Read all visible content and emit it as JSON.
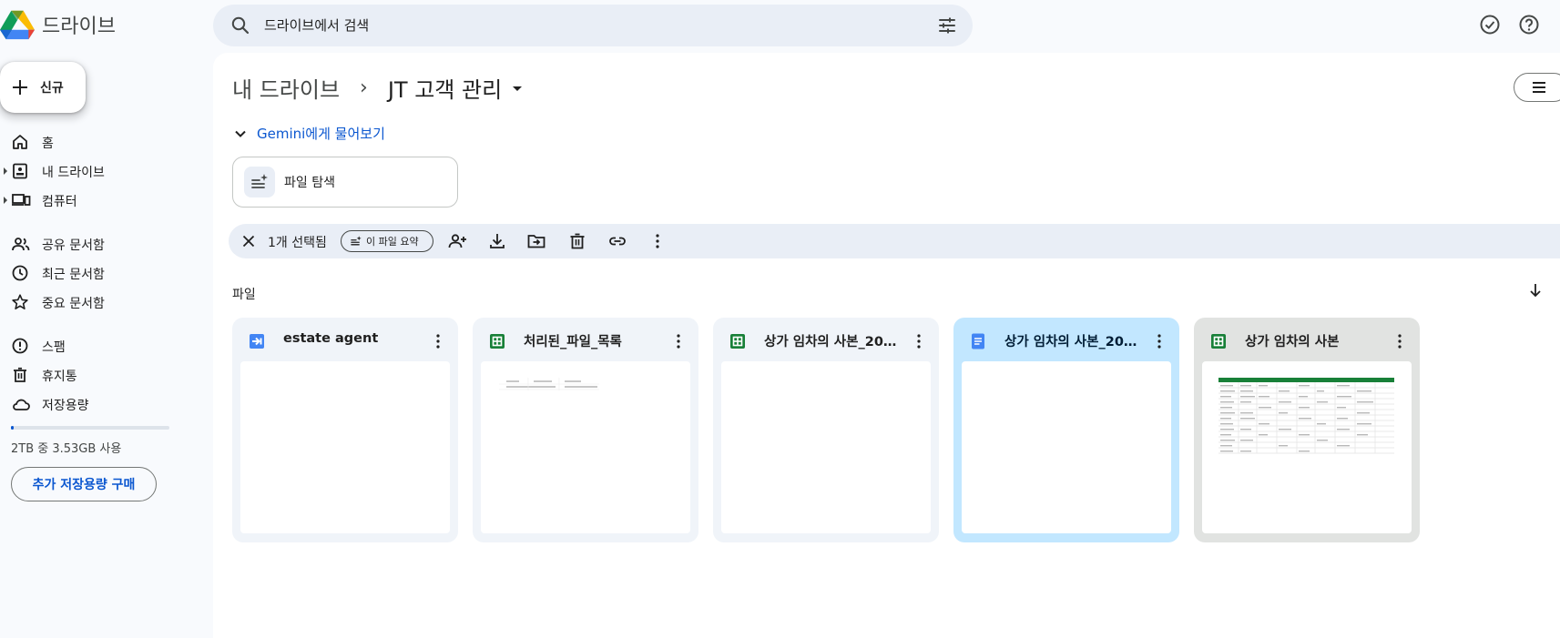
{
  "app": {
    "title": "드라이브"
  },
  "search": {
    "placeholder": "드라이브에서 검색"
  },
  "sidebar": {
    "new_label": "신규",
    "items": [
      {
        "label": "홈",
        "icon": "home-icon"
      },
      {
        "label": "내 드라이브",
        "icon": "my-drive-icon"
      },
      {
        "label": "컴퓨터",
        "icon": "computer-icon"
      },
      {
        "label": "공유 문서함",
        "icon": "shared-icon"
      },
      {
        "label": "최근 문서함",
        "icon": "clock-icon"
      },
      {
        "label": "중요 문서함",
        "icon": "star-icon"
      },
      {
        "label": "스팸",
        "icon": "spam-icon"
      },
      {
        "label": "휴지통",
        "icon": "trash-icon"
      },
      {
        "label": "저장용량",
        "icon": "cloud-icon"
      }
    ],
    "storage_text": "2TB 중 3.53GB 사용",
    "storage_used_fraction": 0.0018,
    "buy_label": "추가 저장용량 구매"
  },
  "breadcrumb": {
    "root": "내 드라이브",
    "separator": "›",
    "current": "JT 고객 관리"
  },
  "gemini": {
    "label": "Gemini에게 물어보기"
  },
  "explore": {
    "label": "파일 탐색"
  },
  "selection": {
    "count_label": "1개 선택됨",
    "summarize_label": "이 파일 요약"
  },
  "files_section": {
    "label": "파일"
  },
  "files": [
    {
      "name": "estate agent",
      "type": "script",
      "state": "normal"
    },
    {
      "name": "처리된_파일_목록",
      "type": "sheet",
      "state": "normal"
    },
    {
      "name": "상가 임차의 사본_2025...",
      "type": "sheet",
      "state": "normal"
    },
    {
      "name": "상가 임차의 사본_2025...",
      "type": "doc",
      "state": "selected"
    },
    {
      "name": "상가 임차의 사본",
      "type": "sheet",
      "state": "hover"
    }
  ],
  "colors": {
    "accent": "#0b57d0",
    "selected_card": "#c2e7ff",
    "sheet_green": "#188038",
    "doc_blue": "#4285f4"
  }
}
